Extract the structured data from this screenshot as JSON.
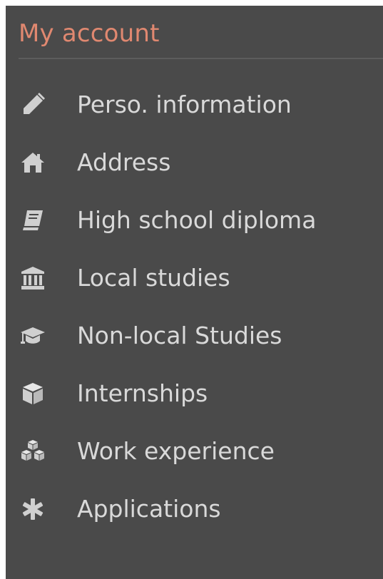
{
  "sidebar": {
    "title": "My account",
    "colors": {
      "background": "#4a4a4a",
      "title": "#e08870",
      "label": "#d9d9d9",
      "icon": "#d0d0d0",
      "divider": "#5d5d5d"
    },
    "items": [
      {
        "label": "Perso. information",
        "icon": "pencil-icon"
      },
      {
        "label": "Address",
        "icon": "home-icon"
      },
      {
        "label": "High school diploma",
        "icon": "book-icon"
      },
      {
        "label": "Local studies",
        "icon": "university-icon"
      },
      {
        "label": "Non-local Studies",
        "icon": "graduation-cap-icon"
      },
      {
        "label": "Internships",
        "icon": "cube-icon"
      },
      {
        "label": "Work experience",
        "icon": "cubes-icon"
      },
      {
        "label": "Applications",
        "icon": "asterisk-icon"
      }
    ]
  }
}
